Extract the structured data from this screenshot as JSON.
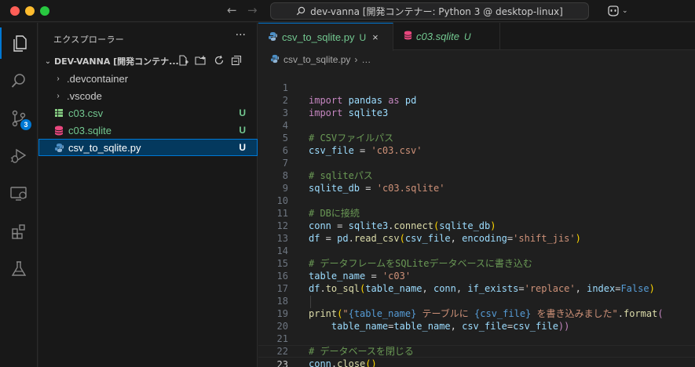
{
  "titlebar": {
    "search_text": "dev-vanna [開発コンテナー: Python 3 @ desktop-linux]"
  },
  "activity": {
    "scm_badge": "3"
  },
  "sidebar": {
    "title": "エクスプローラー",
    "more": "···",
    "folder_name": "DEV-VANNA [開発コンテナ...",
    "items": [
      {
        "label": ".devcontainer",
        "type": "folder",
        "status": ""
      },
      {
        "label": ".vscode",
        "type": "folder",
        "status": ""
      },
      {
        "label": "c03.csv",
        "type": "csv",
        "status": "U"
      },
      {
        "label": "c03.sqlite",
        "type": "sqlite",
        "status": "U"
      },
      {
        "label": "csv_to_sqlite.py",
        "type": "python",
        "status": "U"
      }
    ]
  },
  "tabs": [
    {
      "label": "csv_to_sqlite.py",
      "modified": "U",
      "close": "×"
    },
    {
      "label": "c03.sqlite",
      "modified": "U"
    }
  ],
  "breadcrumb": {
    "file": "csv_to_sqlite.py",
    "rest": "…"
  },
  "editor": {
    "lines": [
      "1",
      "2",
      "3",
      "4",
      "5",
      "6",
      "7",
      "8",
      "9",
      "10",
      "11",
      "12",
      "13",
      "14",
      "15",
      "16",
      "17",
      "18",
      "19",
      "20",
      "21",
      "22",
      "23"
    ],
    "code": {
      "l1": [
        "import",
        "pandas",
        "as",
        "pd"
      ],
      "l2": [
        "import",
        "sqlite3"
      ],
      "l4": "# CSVファイルパス",
      "l5": [
        "csv_file",
        " = ",
        "'c03.csv'"
      ],
      "l7": "# sqliteパス",
      "l8": [
        "sqlite_db",
        " = ",
        "'c03.sqlite'"
      ],
      "l10": "# DBに接続",
      "l11": [
        "conn",
        " = ",
        "sqlite3",
        ".",
        "connect",
        "(",
        "sqlite_db",
        ")"
      ],
      "l12": [
        "df",
        " = ",
        "pd",
        ".",
        "read_csv",
        "(",
        "csv_file",
        ", ",
        "encoding",
        "=",
        "'shift_jis'",
        ")"
      ],
      "l14": "# データフレームをSQLiteデータベースに書き込む",
      "l15": [
        "table_name",
        " = ",
        "'c03'"
      ],
      "l16": [
        "df",
        ".",
        "to_sql",
        "(",
        "table_name",
        ", ",
        "conn",
        ", ",
        "if_exists",
        "=",
        "'replace'",
        ", ",
        "index",
        "=",
        "False",
        ")"
      ],
      "l18": [
        "print",
        "(",
        "\"",
        "{table_name}",
        " テーブルに ",
        "{csv_file}",
        " を書き込みました\"",
        ".",
        "format",
        "("
      ],
      "l19": [
        "    ",
        "table_name",
        "=",
        "table_name",
        ", ",
        "csv_file",
        "=",
        "csv_file",
        "))"
      ],
      "l21": "# データベースを閉じる",
      "l22": [
        "conn",
        ".",
        "close",
        "()"
      ]
    }
  },
  "colors": {
    "accent": "#0078d4",
    "untracked": "#73c991",
    "keyword": "#c586c0",
    "function": "#dcdcaa",
    "variable": "#9cdcfe",
    "string": "#ce9178",
    "comment": "#6a9955"
  }
}
